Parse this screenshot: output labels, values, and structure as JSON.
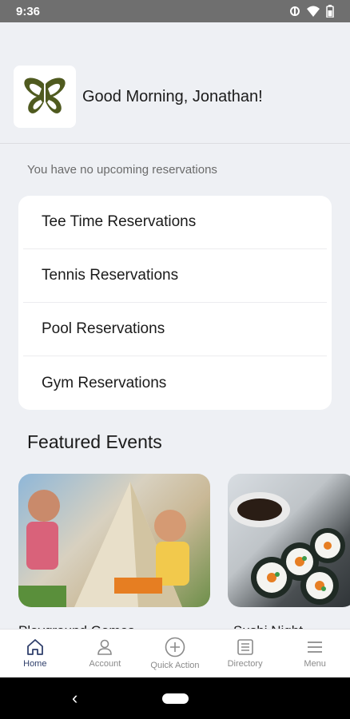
{
  "status_bar": {
    "time": "9:36"
  },
  "header": {
    "greeting": "Good Morning, Jonathan!"
  },
  "reservations": {
    "empty_text": "You have no upcoming reservations",
    "items": [
      {
        "label": "Tee Time Reservations"
      },
      {
        "label": "Tennis Reservations"
      },
      {
        "label": "Pool Reservations"
      },
      {
        "label": "Gym Reservations"
      }
    ]
  },
  "featured": {
    "title": "Featured Events",
    "events": [
      {
        "title": "Playground Games"
      },
      {
        "title": "Sushi Night"
      }
    ]
  },
  "bottom_nav": {
    "items": [
      {
        "label": "Home",
        "icon": "home-icon",
        "active": true
      },
      {
        "label": "Account",
        "icon": "person-icon",
        "active": false
      },
      {
        "label": "Quick Action",
        "icon": "plus-circle-icon",
        "active": false
      },
      {
        "label": "Directory",
        "icon": "directory-icon",
        "active": false
      },
      {
        "label": "Menu",
        "icon": "hamburger-icon",
        "active": false
      }
    ]
  },
  "colors": {
    "accent": "#2f3f6b",
    "logo_green": "#4f5a1f",
    "background": "#eef0f4"
  }
}
